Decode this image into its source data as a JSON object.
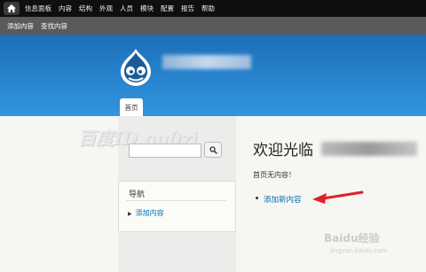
{
  "toolbar": {
    "menu": [
      "信息面板",
      "内容",
      "结构",
      "外观",
      "人员",
      "模块",
      "配置",
      "报告",
      "帮助"
    ]
  },
  "shortcuts": [
    "添加内容",
    "查找内容"
  ],
  "header": {
    "tab_home": "首页"
  },
  "watermark": {
    "text": "百度ID gu0zi",
    "baidu": "Baidu经验",
    "url": "jingyan.baidu.com"
  },
  "main": {
    "title": "欢迎光临",
    "empty_message": "首页无内容！",
    "add_link": "添加新内容"
  },
  "sidebar": {
    "nav_title": "导航",
    "nav_items": [
      "添加内容"
    ]
  },
  "colors": {
    "header_top": "#1b6fb8",
    "header_bottom": "#3295de",
    "link": "#0071b3",
    "arrow": "#e0202a"
  }
}
